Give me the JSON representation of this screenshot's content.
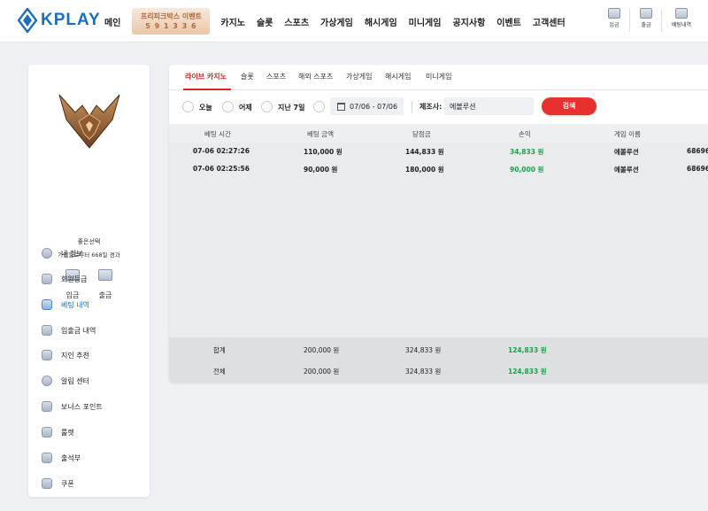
{
  "header": {
    "logo_text": "KPLAY",
    "nav": [
      "메인",
      "카지노",
      "슬롯",
      "스포츠",
      "가상게임",
      "해시게임",
      "미니게임",
      "공지사항",
      "이벤트",
      "고객센터"
    ],
    "promo": {
      "line1": "프리피크박스 이벤트",
      "line2": "5 9 1 3 3 6"
    },
    "icons": [
      {
        "label": "입금",
        "icon": "deposit-icon"
      },
      {
        "label": "출금",
        "icon": "withdraw-icon"
      },
      {
        "label": "배팅내역",
        "icon": "betting-history-icon"
      }
    ]
  },
  "sidebar": {
    "nickname": "좋은선택",
    "joined_text": "가입일로부터 668일 경과",
    "quick": [
      {
        "label": "입금",
        "icon": "wallet-icon"
      },
      {
        "label": "출금",
        "icon": "wallet-icon"
      }
    ],
    "menu": [
      {
        "label": "내 정보",
        "icon": "user-icon"
      },
      {
        "label": "회원등급",
        "icon": "grade-icon"
      },
      {
        "label": "베팅 내역",
        "icon": "betting-icon",
        "active": true
      },
      {
        "label": "입출금 내역",
        "icon": "transaction-icon"
      },
      {
        "label": "지인 추천",
        "icon": "referral-icon"
      },
      {
        "label": "알림 센터",
        "icon": "notification-icon"
      },
      {
        "label": "보너스 포인트",
        "icon": "bonus-icon"
      },
      {
        "label": "룰렛",
        "icon": "roulette-icon"
      },
      {
        "label": "출석부",
        "icon": "attendance-icon"
      },
      {
        "label": "쿠폰",
        "icon": "coupon-icon"
      }
    ]
  },
  "tabs": [
    "라이브 카지노",
    "슬롯",
    "스포츠",
    "해외 스포츠",
    "가상게임",
    "해시게임",
    "미니게임"
  ],
  "filters": {
    "today": "오늘",
    "yesterday": "어제",
    "last7": "지난 7일",
    "date_range": "07/06 - 07/06",
    "provider_label": "제조사:",
    "provider_value": "에볼루션",
    "search_label": "검색"
  },
  "table": {
    "headers": [
      "베팅 시간",
      "베팅 금액",
      "당첨금",
      "손익",
      "게임 이름"
    ],
    "rows": [
      {
        "time": "07-06 02:27:26",
        "bet": "110,000 원",
        "win": "144,833 원",
        "profit": "34,833 원",
        "game": "에볼루션",
        "id": "68696"
      },
      {
        "time": "07-06 02:25:56",
        "bet": "90,000 원",
        "win": "180,000 원",
        "profit": "90,000 원",
        "game": "에볼루션",
        "id": "68696"
      }
    ],
    "totals": [
      {
        "label": "합계",
        "bet": "200,000 원",
        "win": "324,833 원",
        "profit": "124,833 원"
      },
      {
        "label": "전체",
        "bet": "200,000 원",
        "win": "324,833 원",
        "profit": "124,833 원"
      }
    ]
  },
  "colors": {
    "accent_red": "#e02424",
    "profit_green": "#16a34a",
    "brand_blue": "#1b6fc0"
  }
}
